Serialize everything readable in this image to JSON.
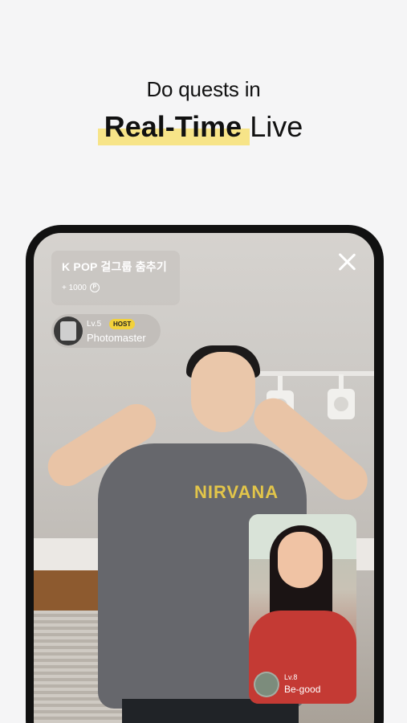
{
  "headline": {
    "line1": "Do quests in",
    "highlight": "Real-Time",
    "rest": "Live",
    "highlight_color": "#f7e488"
  },
  "live": {
    "quest": {
      "title": "K POP 걸그룹 춤추기",
      "points": "+ 1000",
      "points_icon": "P"
    },
    "host": {
      "level": "Lv.5",
      "badge": "HOST",
      "name": "Photomaster",
      "badge_color": "#f2d13b"
    },
    "shirt_print": "NIRVANA",
    "close_icon": "close-icon",
    "guest": {
      "level": "Lv.8",
      "name": "Be-good"
    }
  }
}
